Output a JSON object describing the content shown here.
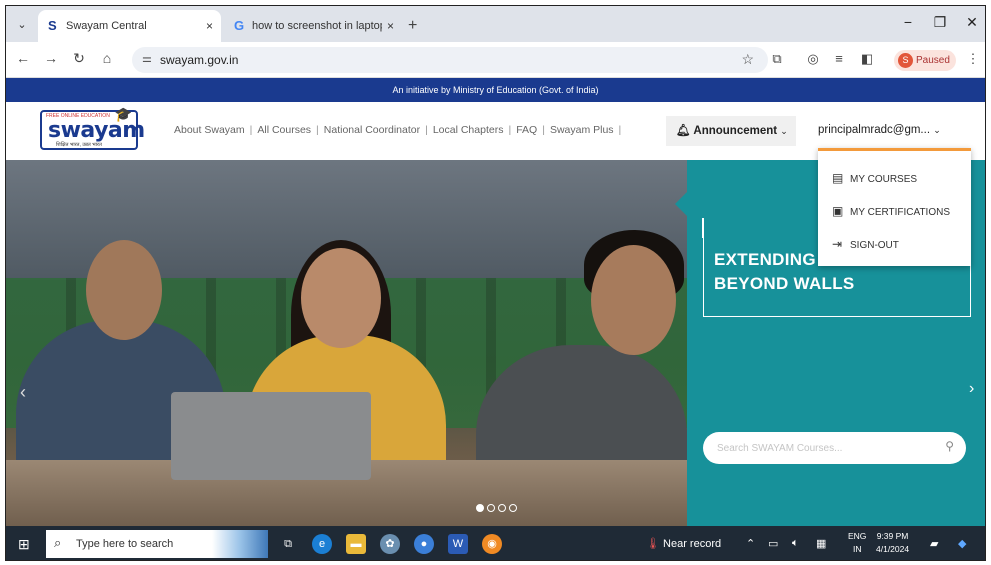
{
  "browser": {
    "tabs": [
      {
        "favicon": "S",
        "title": "Swayam Central",
        "close": "×"
      },
      {
        "favicon": "G",
        "title": "how to screenshot in laptop - G",
        "close": "×"
      }
    ],
    "new_tab": "+",
    "url": "swayam.gov.in",
    "profile_initial": "S",
    "profile_status": "Paused"
  },
  "page": {
    "banner": "An initiative by Ministry of Education (Govt. of India)",
    "logo": {
      "word": "swayam",
      "tag": "FREE ONLINE EDUCATION",
      "sub": "शिक्षित भारत, उन्नत भारत"
    },
    "nav": [
      "About Swayam",
      "All Courses",
      "National Coordinator",
      "Local Chapters",
      "FAQ",
      "Swayam Plus"
    ],
    "announcement": "Announcement",
    "user": "principalmradc@gm...",
    "dropdown": [
      "MY COURSES",
      "MY CERTIFICATIONS",
      "SIGN-OUT"
    ],
    "hero_line1": "EXTENDING",
    "hero_line2": "BEYOND WALLS",
    "search_placeholder": "Search SWAYAM Courses...",
    "slider_dots": 4,
    "active_dot": 1
  },
  "taskbar": {
    "search_placeholder": "Type here to search",
    "near_record": "Near record",
    "lang_top": "ENG",
    "lang_bottom": "IN",
    "time": "9:39 PM",
    "date": "4/1/2024"
  },
  "colors": {
    "banner": "#1a3a8f",
    "teal": "#17919a",
    "dropdown_accent": "#f39a3b",
    "taskbar": "#1f2a36"
  }
}
